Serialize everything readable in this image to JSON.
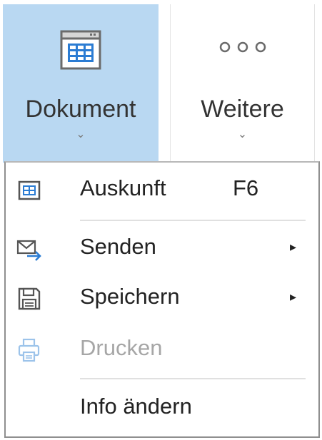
{
  "ribbon": {
    "dokument": {
      "label": "Dokument",
      "chevron": "⌄",
      "icon": "form-window-icon"
    },
    "weitere": {
      "label": "Weitere",
      "chevron": "⌄",
      "icon": "more-dots-icon"
    }
  },
  "menu": {
    "items": [
      {
        "label": "Auskunft",
        "shortcut": "F6",
        "icon": "info-table-icon",
        "disabled": false
      },
      {
        "label": "Senden",
        "submenu_arrow": "▸",
        "icon": "send-envelope-icon",
        "disabled": false
      },
      {
        "label": "Speichern",
        "submenu_arrow": "▸",
        "icon": "save-disk-icon",
        "disabled": false
      },
      {
        "label": "Drucken",
        "icon": "print-icon",
        "disabled": true
      },
      {
        "label": "Info ändern",
        "disabled": false
      }
    ]
  },
  "colors": {
    "ribbon_selected": "#b9d8f2",
    "icon_blue": "#2b7cd3",
    "disabled_text": "#a6a6a6"
  }
}
